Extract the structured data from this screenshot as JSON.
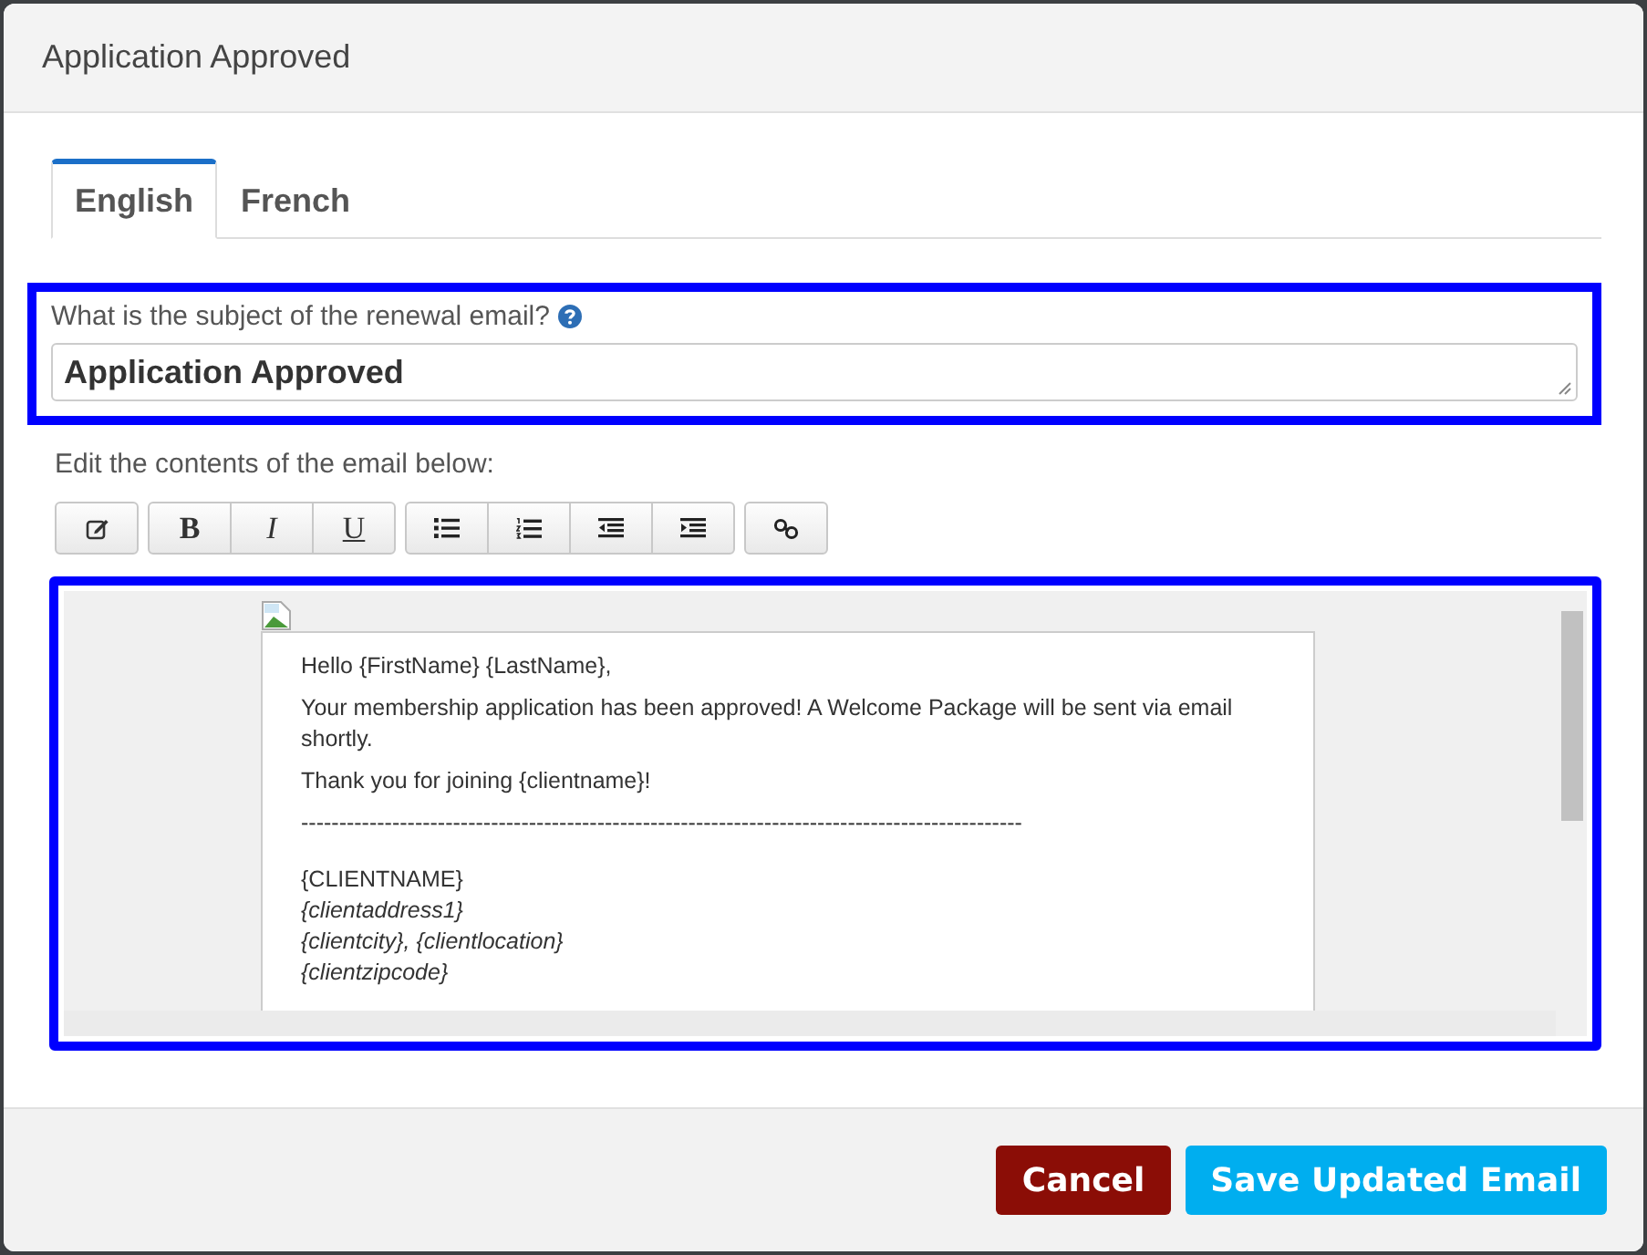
{
  "dialog": {
    "title": "Application Approved"
  },
  "tabs": [
    {
      "label": "English",
      "selected": true
    },
    {
      "label": "French",
      "selected": false
    }
  ],
  "subject": {
    "label": "What is the subject of the renewal email?",
    "value": "Application Approved"
  },
  "editor_label": "Edit the contents of the email below:",
  "toolbar": [
    [
      {
        "kind": "edit"
      }
    ],
    [
      {
        "kind": "bold",
        "label": "B"
      },
      {
        "kind": "italic",
        "label": "I"
      },
      {
        "kind": "underline",
        "label": "U"
      }
    ],
    [
      {
        "kind": "bullets"
      },
      {
        "kind": "numbers"
      },
      {
        "kind": "outdent"
      },
      {
        "kind": "indent"
      }
    ],
    [
      {
        "kind": "link"
      }
    ]
  ],
  "email": [
    {
      "kind": "para",
      "text": "Hello {FirstName} {LastName},"
    },
    {
      "kind": "para",
      "text": "Your membership application has been approved!  A Welcome Package will be sent via email shortly."
    },
    {
      "kind": "para",
      "text": "Thank you for joining {clientname}!"
    },
    {
      "kind": "para",
      "text": "-----------------------------------------------------------------------------------------------"
    },
    {
      "kind": "line",
      "text": "{CLIENTNAME}"
    },
    {
      "kind": "italic",
      "text": "{clientaddress1}"
    },
    {
      "kind": "italic",
      "text": "{clientcity}, {clientlocation}"
    },
    {
      "kind": "italic",
      "text": "{clientzipcode}"
    }
  ],
  "buttons": [
    {
      "kind": "cancel",
      "label": "Cancel"
    },
    {
      "kind": "save",
      "label": "Save Updated Email"
    }
  ]
}
